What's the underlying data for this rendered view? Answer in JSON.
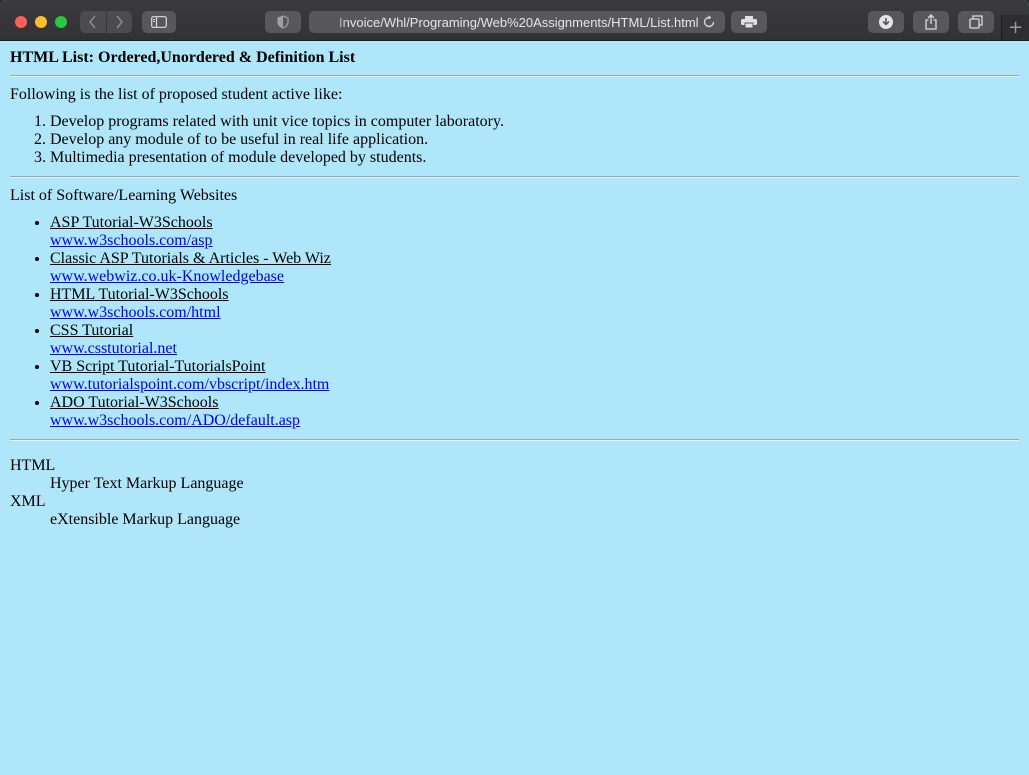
{
  "browser": {
    "address": "Invoice/Whl/Programing/Web%20Assignments/HTML/List.html",
    "new_tab_glyph": "+"
  },
  "page": {
    "heading": "HTML List: Ordered,Unordered & Definition List",
    "intro": "Following is the list of proposed student active like:",
    "ordered_items": [
      "Develop programs related with unit vice topics in computer laboratory.",
      "Develop any module of to be useful in real life application.",
      "Multimedia presentation of module developed by students."
    ],
    "websites_heading": "List of Software/Learning Websites",
    "websites": [
      {
        "title": "ASP Tutorial-W3Schools",
        "url": "www.w3schools.com/asp"
      },
      {
        "title": "Classic ASP Tutorials & Articles - Web Wiz",
        "url": "www.webwiz.co.uk-Knowledgebase"
      },
      {
        "title": "HTML Tutorial-W3Schools",
        "url": "www.w3schools.com/html"
      },
      {
        "title": "CSS Tutorial",
        "url": "www.csstutorial.net"
      },
      {
        "title": "VB Script Tutorial-TutorialsPoint",
        "url": "www.tutorialspoint.com/vbscript/index.htm"
      },
      {
        "title": "ADO Tutorial-W3Schools",
        "url": "www.w3schools.com/ADO/default.asp"
      }
    ],
    "definitions": [
      {
        "term": "HTML",
        "description": "Hyper Text Markup Language"
      },
      {
        "term": "XML",
        "description": "eXtensible Markup Language"
      }
    ]
  },
  "colors": {
    "page_background": "#afe6f9",
    "link": "#0000ee",
    "toolbar": "#3b3b3d"
  },
  "icons": [
    "close-window-icon",
    "minimize-window-icon",
    "zoom-window-icon",
    "back-icon",
    "forward-icon",
    "sidebar-icon",
    "shield-icon",
    "reload-icon",
    "print-icon",
    "download-icon",
    "share-icon",
    "tabs-overview-icon",
    "new-tab-icon"
  ]
}
